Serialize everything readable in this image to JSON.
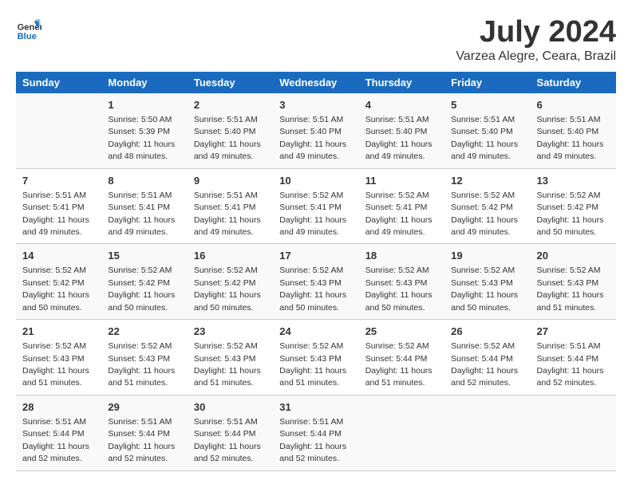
{
  "logo": {
    "line1": "General",
    "line2": "Blue"
  },
  "title": "July 2024",
  "subtitle": "Varzea Alegre, Ceara, Brazil",
  "weekdays": [
    "Sunday",
    "Monday",
    "Tuesday",
    "Wednesday",
    "Thursday",
    "Friday",
    "Saturday"
  ],
  "weeks": [
    [
      {
        "day": "",
        "info": ""
      },
      {
        "day": "1",
        "info": "Sunrise: 5:50 AM\nSunset: 5:39 PM\nDaylight: 11 hours\nand 48 minutes."
      },
      {
        "day": "2",
        "info": "Sunrise: 5:51 AM\nSunset: 5:40 PM\nDaylight: 11 hours\nand 49 minutes."
      },
      {
        "day": "3",
        "info": "Sunrise: 5:51 AM\nSunset: 5:40 PM\nDaylight: 11 hours\nand 49 minutes."
      },
      {
        "day": "4",
        "info": "Sunrise: 5:51 AM\nSunset: 5:40 PM\nDaylight: 11 hours\nand 49 minutes."
      },
      {
        "day": "5",
        "info": "Sunrise: 5:51 AM\nSunset: 5:40 PM\nDaylight: 11 hours\nand 49 minutes."
      },
      {
        "day": "6",
        "info": "Sunrise: 5:51 AM\nSunset: 5:40 PM\nDaylight: 11 hours\nand 49 minutes."
      }
    ],
    [
      {
        "day": "7",
        "info": "Sunrise: 5:51 AM\nSunset: 5:41 PM\nDaylight: 11 hours\nand 49 minutes."
      },
      {
        "day": "8",
        "info": "Sunrise: 5:51 AM\nSunset: 5:41 PM\nDaylight: 11 hours\nand 49 minutes."
      },
      {
        "day": "9",
        "info": "Sunrise: 5:51 AM\nSunset: 5:41 PM\nDaylight: 11 hours\nand 49 minutes."
      },
      {
        "day": "10",
        "info": "Sunrise: 5:52 AM\nSunset: 5:41 PM\nDaylight: 11 hours\nand 49 minutes."
      },
      {
        "day": "11",
        "info": "Sunrise: 5:52 AM\nSunset: 5:41 PM\nDaylight: 11 hours\nand 49 minutes."
      },
      {
        "day": "12",
        "info": "Sunrise: 5:52 AM\nSunset: 5:42 PM\nDaylight: 11 hours\nand 49 minutes."
      },
      {
        "day": "13",
        "info": "Sunrise: 5:52 AM\nSunset: 5:42 PM\nDaylight: 11 hours\nand 50 minutes."
      }
    ],
    [
      {
        "day": "14",
        "info": "Sunrise: 5:52 AM\nSunset: 5:42 PM\nDaylight: 11 hours\nand 50 minutes."
      },
      {
        "day": "15",
        "info": "Sunrise: 5:52 AM\nSunset: 5:42 PM\nDaylight: 11 hours\nand 50 minutes."
      },
      {
        "day": "16",
        "info": "Sunrise: 5:52 AM\nSunset: 5:42 PM\nDaylight: 11 hours\nand 50 minutes."
      },
      {
        "day": "17",
        "info": "Sunrise: 5:52 AM\nSunset: 5:43 PM\nDaylight: 11 hours\nand 50 minutes."
      },
      {
        "day": "18",
        "info": "Sunrise: 5:52 AM\nSunset: 5:43 PM\nDaylight: 11 hours\nand 50 minutes."
      },
      {
        "day": "19",
        "info": "Sunrise: 5:52 AM\nSunset: 5:43 PM\nDaylight: 11 hours\nand 50 minutes."
      },
      {
        "day": "20",
        "info": "Sunrise: 5:52 AM\nSunset: 5:43 PM\nDaylight: 11 hours\nand 51 minutes."
      }
    ],
    [
      {
        "day": "21",
        "info": "Sunrise: 5:52 AM\nSunset: 5:43 PM\nDaylight: 11 hours\nand 51 minutes."
      },
      {
        "day": "22",
        "info": "Sunrise: 5:52 AM\nSunset: 5:43 PM\nDaylight: 11 hours\nand 51 minutes."
      },
      {
        "day": "23",
        "info": "Sunrise: 5:52 AM\nSunset: 5:43 PM\nDaylight: 11 hours\nand 51 minutes."
      },
      {
        "day": "24",
        "info": "Sunrise: 5:52 AM\nSunset: 5:43 PM\nDaylight: 11 hours\nand 51 minutes."
      },
      {
        "day": "25",
        "info": "Sunrise: 5:52 AM\nSunset: 5:44 PM\nDaylight: 11 hours\nand 51 minutes."
      },
      {
        "day": "26",
        "info": "Sunrise: 5:52 AM\nSunset: 5:44 PM\nDaylight: 11 hours\nand 52 minutes."
      },
      {
        "day": "27",
        "info": "Sunrise: 5:51 AM\nSunset: 5:44 PM\nDaylight: 11 hours\nand 52 minutes."
      }
    ],
    [
      {
        "day": "28",
        "info": "Sunrise: 5:51 AM\nSunset: 5:44 PM\nDaylight: 11 hours\nand 52 minutes."
      },
      {
        "day": "29",
        "info": "Sunrise: 5:51 AM\nSunset: 5:44 PM\nDaylight: 11 hours\nand 52 minutes."
      },
      {
        "day": "30",
        "info": "Sunrise: 5:51 AM\nSunset: 5:44 PM\nDaylight: 11 hours\nand 52 minutes."
      },
      {
        "day": "31",
        "info": "Sunrise: 5:51 AM\nSunset: 5:44 PM\nDaylight: 11 hours\nand 52 minutes."
      },
      {
        "day": "",
        "info": ""
      },
      {
        "day": "",
        "info": ""
      },
      {
        "day": "",
        "info": ""
      }
    ]
  ]
}
